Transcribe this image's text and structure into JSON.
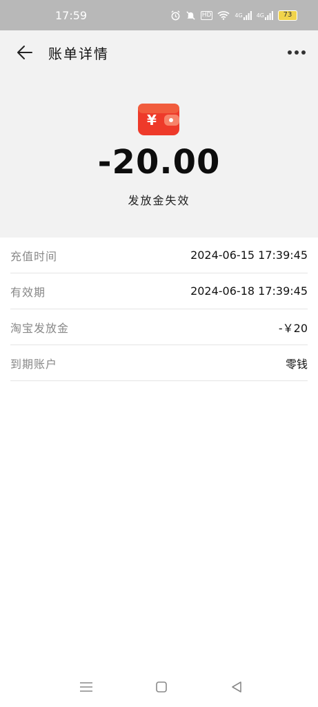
{
  "status_bar": {
    "time": "17:59",
    "hd_label": "HD",
    "signal1_label": "4G",
    "signal2_label": "4G",
    "battery_level": "73",
    "icons": [
      "alarm-icon",
      "mute-icon",
      "hd-icon",
      "wifi-icon",
      "signal-icon",
      "signal-icon",
      "battery-icon"
    ]
  },
  "nav": {
    "title": "账单详情",
    "back_icon": "arrow-left-icon",
    "more_icon": "more-dots-icon"
  },
  "summary": {
    "icon": "wallet-icon",
    "icon_symbol": "¥",
    "amount": "-20.00",
    "description": "发放金失效",
    "accent_color": "#f0392b"
  },
  "details": [
    {
      "label": "充值时间",
      "value": "2024-06-15 17:39:45"
    },
    {
      "label": "有效期",
      "value": "2024-06-18 17:39:45"
    },
    {
      "label": "淘宝发放金",
      "value": "-￥20"
    },
    {
      "label": "到期账户",
      "value": "零钱"
    }
  ],
  "system_nav": {
    "icons": [
      "menu-icon",
      "home-square-icon",
      "back-triangle-icon"
    ]
  }
}
